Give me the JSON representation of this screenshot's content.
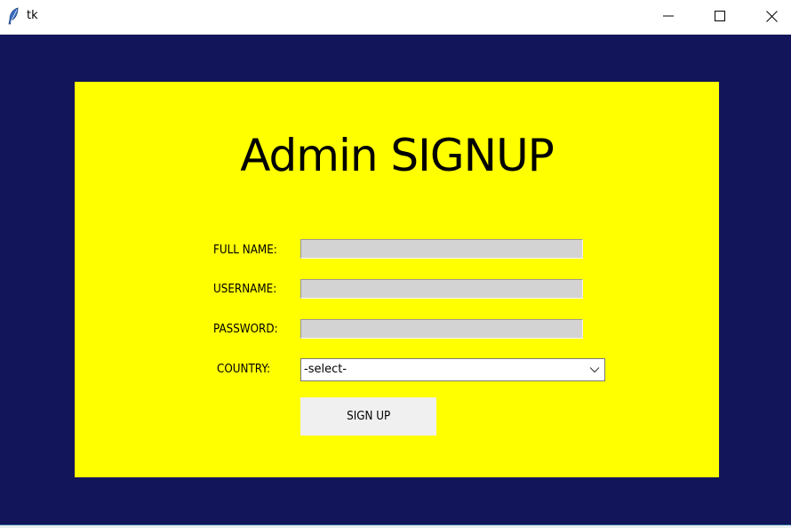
{
  "window": {
    "title": "tk",
    "app_icon": "feather-icon",
    "controls": [
      "minimize-icon",
      "maximize-icon",
      "close-icon"
    ]
  },
  "colors": {
    "window_background": "#12155a",
    "panel_background": "#ffff00",
    "entry_background": "#d3d3d3",
    "button_background": "#f0f0f0"
  },
  "form": {
    "heading": "Admin SIGNUP",
    "full_name_label": "FULL NAME:",
    "full_name_value": "",
    "username_label": "USERNAME:",
    "username_value": "",
    "password_label": "PASSWORD:",
    "password_value": "",
    "country_label": "COUNTRY:",
    "country_selected": "-select-",
    "signup_button": "SIGN UP"
  }
}
